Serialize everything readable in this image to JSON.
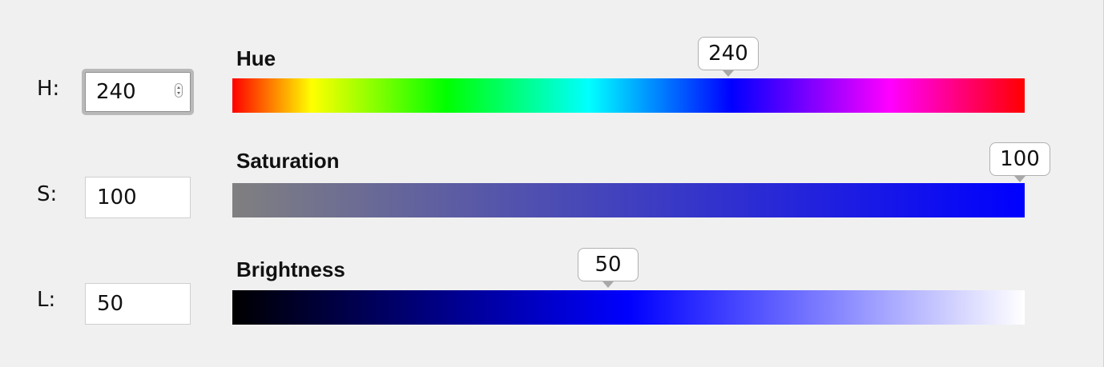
{
  "rows": {
    "hue": {
      "label": "H:",
      "value": "240",
      "title": "Hue",
      "tooltip": "240",
      "level": 0.6667
    },
    "saturation": {
      "label": "S:",
      "value": "100",
      "title": "Saturation",
      "tooltip": "100",
      "level": 1.0
    },
    "brightness": {
      "label": "L:",
      "value": "50",
      "title": "Brightness",
      "tooltip": "50",
      "level": 0.5
    }
  },
  "colors": {
    "background": "#f0f0f0",
    "selected": "#0000ff"
  }
}
